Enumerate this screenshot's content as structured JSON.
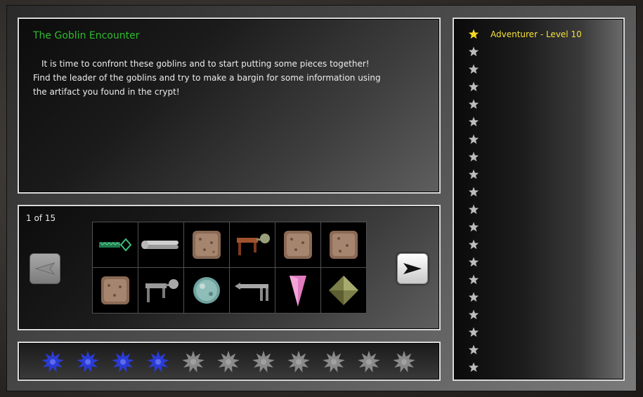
{
  "quest": {
    "title": "The Goblin Encounter",
    "description": "It is time to confront these goblins and to start putting some pieces together! Find the leader of the goblins and try to make a bargin for some information using the artifact you found in the crypt!"
  },
  "inventory": {
    "page_indicator": "1 of 15",
    "items": [
      {
        "icon": "chain-key-icon"
      },
      {
        "icon": "bone-rod-icon"
      },
      {
        "icon": "stone-tile-icon"
      },
      {
        "icon": "wooden-stool-icon"
      },
      {
        "icon": "stone-tile-icon"
      },
      {
        "icon": "stone-tile-icon"
      },
      {
        "icon": "stone-tile-icon"
      },
      {
        "icon": "stone-pestle-icon"
      },
      {
        "icon": "crystal-orb-icon"
      },
      {
        "icon": "stone-bench-icon"
      },
      {
        "icon": "pink-crystal-icon"
      },
      {
        "icon": "olive-gem-icon"
      }
    ]
  },
  "progress": {
    "earned": 4,
    "total": 11,
    "earned_color": "#2b3bd6",
    "unearned_color": "#8a8a8a"
  },
  "ranks": {
    "achieved_label": "Adventurer - Level 10",
    "achieved_color": "#f5d81f",
    "unachieved_color": "#bdbdbd",
    "slots": 20
  }
}
